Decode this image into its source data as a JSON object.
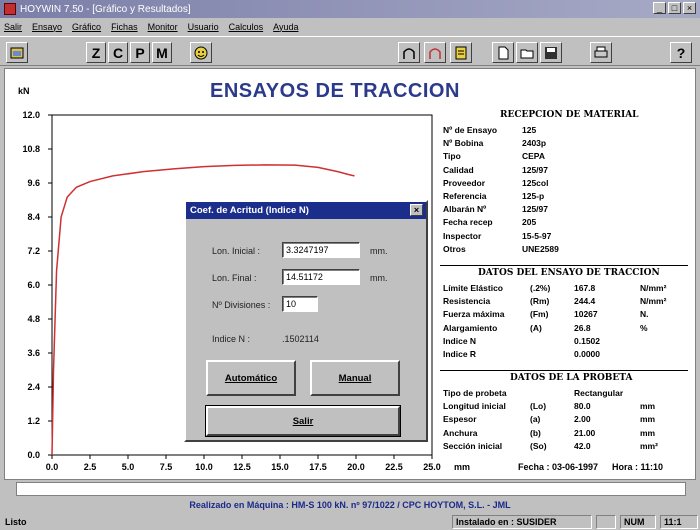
{
  "window": {
    "title": "HOYWIN 7.50 - [Gráfico y Resultados]",
    "controls": [
      "_",
      "□",
      "×"
    ]
  },
  "menu": [
    "Salir",
    "Ensayo",
    "Gráfico",
    "Fichas",
    "Monitor",
    "Usuario",
    "Calculos",
    "Ayuda"
  ],
  "toolbar": {
    "letters": [
      "Z",
      "C",
      "P",
      "M"
    ],
    "help_label": "?"
  },
  "chart_title": "ENSAYOS DE TRACCION",
  "chart_data": {
    "type": "line",
    "title": "ENSAYOS DE TRACCION",
    "ylabel": "kN",
    "xlabel": "mm",
    "xlim": [
      0,
      25
    ],
    "ylim": [
      0,
      12
    ],
    "x_ticks": [
      "0.0",
      "2.5",
      "5.0",
      "7.5",
      "10.0",
      "12.5",
      "15.0",
      "17.5",
      "20.0",
      "22.5",
      "25.0"
    ],
    "y_ticks": [
      "0.0",
      "1.2",
      "2.4",
      "3.6",
      "4.8",
      "6.0",
      "7.2",
      "8.4",
      "9.6",
      "10.8",
      "12.0"
    ],
    "series": [
      {
        "color": "#d03030",
        "x": [
          0,
          0.1,
          0.3,
          0.6,
          1.0,
          1.6,
          2.5,
          4.0,
          6.0,
          8.0,
          10.0,
          12.0,
          14.0,
          16.0,
          17.5,
          18.8,
          19.5,
          19.9
        ],
        "y": [
          0,
          3.0,
          6.5,
          8.4,
          9.1,
          9.45,
          9.65,
          9.85,
          10.0,
          10.1,
          10.18,
          10.22,
          10.24,
          10.23,
          10.15,
          10.0,
          9.9,
          9.85
        ]
      }
    ]
  },
  "recepcion": {
    "header": "RECEPCION DE MATERIAL",
    "rows": [
      {
        "k": "Nº de Ensayo",
        "v": "125"
      },
      {
        "k": "Nº Bobina",
        "v": "2403p"
      },
      {
        "k": "Tipo",
        "v": "CEPA"
      },
      {
        "k": "Calidad",
        "v": "125/97"
      },
      {
        "k": "Proveedor",
        "v": "125col"
      },
      {
        "k": "Referencia",
        "v": "125-p"
      },
      {
        "k": "Albarán Nº",
        "v": "125/97"
      },
      {
        "k": "Fecha recep",
        "v": "205"
      },
      {
        "k": "Inspector",
        "v": "15-5-97"
      },
      {
        "k": "Otros",
        "v": "UNE2589"
      }
    ]
  },
  "datos": {
    "header": "DATOS DEL ENSAYO DE TRACCION",
    "rows": [
      {
        "k": "Límite Elástico",
        "s": "(.2%)",
        "v": "167.8",
        "u": "N/mm²"
      },
      {
        "k": "Resistencia",
        "s": "(Rm)",
        "v": "244.4",
        "u": "N/mm²"
      },
      {
        "k": "Fuerza máxima",
        "s": "(Fm)",
        "v": "10267",
        "u": "N."
      },
      {
        "k": "Alargamiento",
        "s": "(A)",
        "v": "26.8",
        "u": "%"
      },
      {
        "k": "Indice N",
        "s": "",
        "v": "0.1502",
        "u": ""
      },
      {
        "k": "Indice R",
        "s": "",
        "v": "0.0000",
        "u": ""
      }
    ]
  },
  "probeta": {
    "header": "DATOS DE LA PROBETA",
    "rows": [
      {
        "k": "Tipo de probeta",
        "s": "",
        "v": "Rectangular",
        "u": ""
      },
      {
        "k": "Longitud inicial",
        "s": "(Lo)",
        "v": "80.0",
        "u": "mm"
      },
      {
        "k": "Espesor",
        "s": "(a)",
        "v": "2.00",
        "u": "mm"
      },
      {
        "k": "Anchura",
        "s": "(b)",
        "v": "21.00",
        "u": "mm"
      },
      {
        "k": "Sección inicial",
        "s": "(So)",
        "v": "42.0",
        "u": "mm²"
      }
    ]
  },
  "footer": {
    "fecha": "Fecha : 03-06-1997",
    "hora": "Hora : 11:10"
  },
  "realizado": "Realizado en Máquina : HM-S 100 kN. nº 97/1022 / CPC HOYTOM, S.L. - JML",
  "status": {
    "left": "Listo",
    "instalado": "Instalado en : SUSIDER",
    "num": "NUM",
    "time": "11:1"
  },
  "dialog": {
    "title": "Coef. de Acritud (Indice N)",
    "lon_inicial_label": "Lon. Inicial :",
    "lon_inicial_value": "3.3247197",
    "lon_inicial_unit": "mm.",
    "lon_final_label": "Lon. Final :",
    "lon_final_value": "14.51172",
    "lon_final_unit": "mm.",
    "divisiones_label": "Nº Divisiones :",
    "divisiones_value": "10",
    "indice_label": "Indice N :",
    "indice_value": ".1502114",
    "automatico": "Automático",
    "manual": "Manual",
    "salir": "Salir"
  }
}
